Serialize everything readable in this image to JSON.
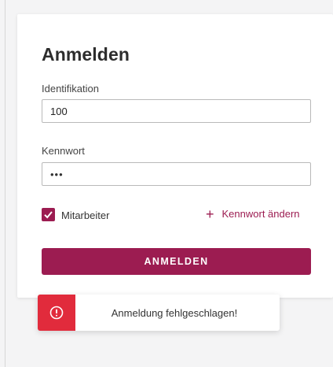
{
  "login": {
    "title": "Anmelden",
    "identification_label": "Identifikation",
    "identification_value": "100",
    "password_label": "Kennwort",
    "password_value": "•••",
    "employee_checkbox_label": "Mitarbeiter",
    "employee_checked": true,
    "change_password_label": "Kennwort ändern",
    "submit_label": "ANMELDEN"
  },
  "toast": {
    "message": "Anmeldung fehlgeschlagen!",
    "icon": "error-circle-icon"
  },
  "colors": {
    "accent": "#9c1c51",
    "error": "#e12b3c"
  }
}
